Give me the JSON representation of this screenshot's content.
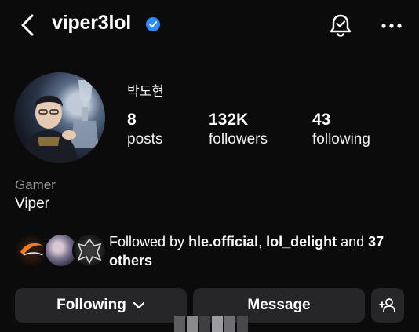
{
  "header": {
    "back_icon": "chevron-left-icon",
    "username": "viper3lol",
    "verified_icon": "verified-badge-icon",
    "notification_icon": "bell-icon",
    "more_icon": "more-horizontal-icon"
  },
  "profile": {
    "full_name": "박도현",
    "stats": [
      {
        "value": "8",
        "label": "posts"
      },
      {
        "value": "132K",
        "label": "followers"
      },
      {
        "value": "43",
        "label": "following"
      }
    ],
    "category": "Gamer",
    "bio": "Viper"
  },
  "followed_by": {
    "prefix": "Followed by ",
    "user1": "hle.official",
    "separator": ", ",
    "user2": "lol_delight",
    "and_text": " and ",
    "count": "37",
    "suffix": "others"
  },
  "actions": {
    "following_label": "Following",
    "message_label": "Message",
    "suggest_icon": "add-person-icon"
  },
  "colors": {
    "background": "#0b0b0c",
    "button_bg": "#262628",
    "verified": "#2f8cf5",
    "muted_text": "#9a9a9f"
  }
}
